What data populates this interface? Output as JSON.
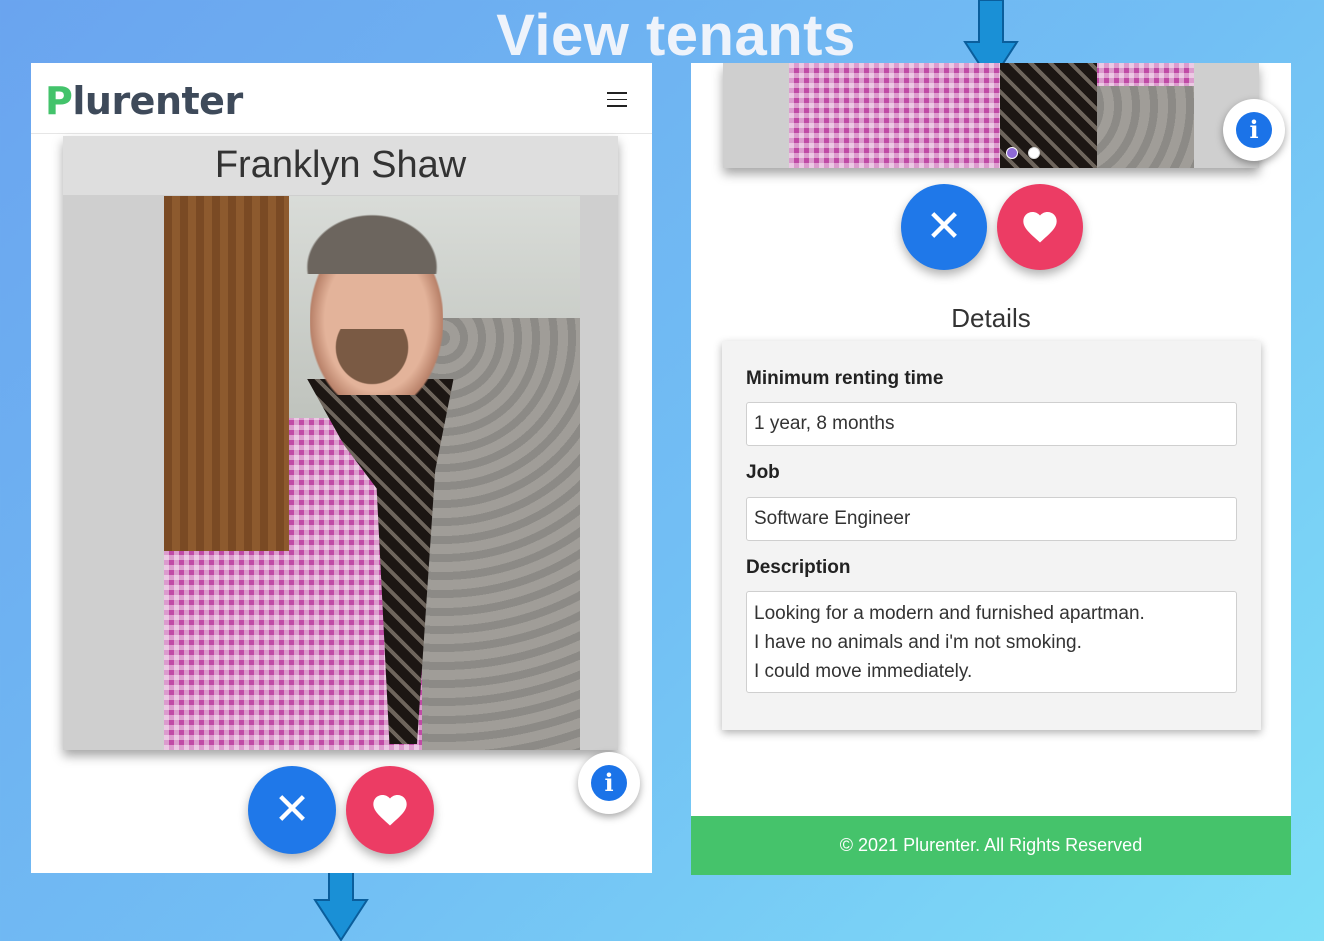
{
  "slide": {
    "title": "View tenants"
  },
  "brand": {
    "first_letter": "P",
    "rest": "lurenter"
  },
  "profile": {
    "name": "Franklyn Shaw",
    "photo_count": 2,
    "active_photo": 1
  },
  "actions": {
    "reject_icon": "close-icon",
    "like_icon": "heart-icon",
    "info_icon": "info-icon"
  },
  "details": {
    "title": "Details",
    "min_renting_label": "Minimum renting time",
    "min_renting_value": "1 year, 8 months",
    "job_label": "Job",
    "job_value": "Software Engineer",
    "description_label": "Description",
    "description_lines": [
      "Looking for a modern and furnished apartman.",
      "I have no animals and i'm not smoking.",
      "I could move immediately."
    ]
  },
  "footer": {
    "text": "© 2021 Plurenter. All Rights Reserved"
  },
  "colors": {
    "brand_green": "#43c36b",
    "reject_blue": "#1f78e9",
    "like_red": "#ec3c64",
    "footer_green": "#45c36b",
    "arrow_blue": "#1a90d6"
  }
}
